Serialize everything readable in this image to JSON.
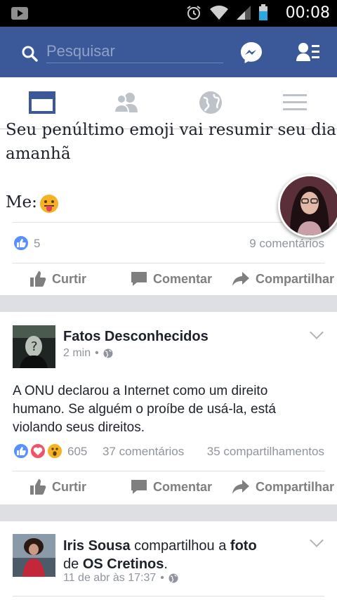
{
  "status_bar": {
    "time": "00:08"
  },
  "header": {
    "search_placeholder": "Pesquisar"
  },
  "tabs": [
    {
      "name": "news-feed",
      "active": true
    },
    {
      "name": "friends",
      "active": false
    },
    {
      "name": "notifications",
      "active": false
    },
    {
      "name": "menu",
      "active": false
    }
  ],
  "colors": {
    "brand": "#3b5998",
    "like_blue": "#5890ff",
    "love_red": "#f25268",
    "wow_yellow": "#f7b125"
  },
  "post1": {
    "text_line1": "Seu penúltimo emoji vai resumir seu dia",
    "text_line2": "amanhã",
    "text_line3": "Me:",
    "reaction_count": "5",
    "comments": "9 comentários",
    "actions": {
      "like": "Curtir",
      "comment": "Comentar",
      "share": "Compartilhar"
    }
  },
  "post2": {
    "page_name": "Fatos Desconhecidos",
    "time": "2 min",
    "text": "A ONU declarou a Internet como um direito humano. Se alguém o proíbe de usá-la, está violando seus direitos.",
    "reaction_count": "605",
    "comments": "37 comentários",
    "shares": "35 compartilhamentos",
    "actions": {
      "like": "Curtir",
      "comment": "Comentar",
      "share": "Compartilhar"
    }
  },
  "post3": {
    "author": "Iris Sousa",
    "shared_text": "compartilhou a",
    "object": "foto",
    "prep": "de",
    "source": "OS Cretinos",
    "period": ".",
    "time": "11 de abr às 17:37"
  }
}
